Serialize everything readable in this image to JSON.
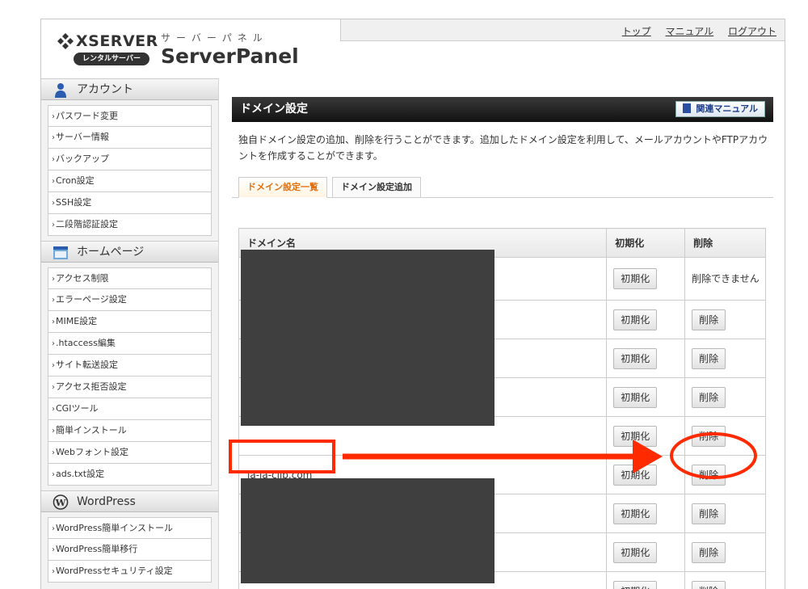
{
  "header": {
    "brand": "XSERVER",
    "rental_badge": "レンタルサーバー",
    "product_kana": "サーバーパネル",
    "product_name": "ServerPanel",
    "nav": [
      "トップ",
      "マニュアル",
      "ログアウト"
    ]
  },
  "sidebar": {
    "sections": [
      {
        "title": "アカウント",
        "icon": "user-icon",
        "items": [
          "パスワード変更",
          "サーバー情報",
          "バックアップ",
          "Cron設定",
          "SSH設定",
          "二段階認証設定"
        ]
      },
      {
        "title": "ホームページ",
        "icon": "homepage-icon",
        "items": [
          "アクセス制限",
          "エラーページ設定",
          "MIME設定",
          ".htaccess編集",
          "サイト転送設定",
          "アクセス拒否設定",
          "CGIツール",
          "簡単インストール",
          "Webフォント設定",
          "ads.txt設定"
        ]
      },
      {
        "title": "WordPress",
        "icon": "wordpress-icon",
        "items": [
          "WordPress簡単インストール",
          "WordPress簡単移行",
          "WordPressセキュリティ設定"
        ]
      }
    ]
  },
  "main": {
    "title": "ドメイン設定",
    "manual_button": "関連マニュアル",
    "description": "独自ドメイン設定の追加、削除を行うことができます。追加したドメイン設定を利用して、メールアカウントやFTPアカウントを作成することができます。",
    "tabs": [
      "ドメイン設定一覧",
      "ドメイン設定追加"
    ],
    "table": {
      "headers": [
        "ドメイン名",
        "初期化",
        "削除"
      ],
      "init_label": "初期化",
      "delete_label": "削除",
      "cannot_delete": "削除できません",
      "highlight_domain": "la-la-clip.com"
    }
  },
  "colors": {
    "annotation": "#ff2a00",
    "active_tab": "#e07010",
    "titlebar": "#1c1c1c"
  }
}
